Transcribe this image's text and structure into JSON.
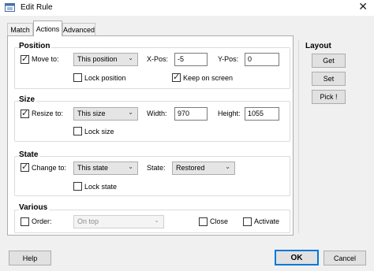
{
  "window": {
    "title": "Edit Rule",
    "close_glyph": "✕",
    "app_icon": "window-rule-icon"
  },
  "tabs": [
    {
      "label": "Match",
      "active": false
    },
    {
      "label": "Actions",
      "active": true
    },
    {
      "label": "Advanced",
      "active": false
    }
  ],
  "position": {
    "title": "Position",
    "move_to": {
      "label": "Move to:",
      "checked": true
    },
    "mode_select": "This position",
    "xpos_label": "X-Pos:",
    "xpos_value": "-5",
    "ypos_label": "Y-Pos:",
    "ypos_value": "0",
    "lock_position": {
      "label": "Lock position",
      "checked": false
    },
    "keep_on_screen": {
      "label": "Keep on screen",
      "checked": true
    }
  },
  "size": {
    "title": "Size",
    "resize_to": {
      "label": "Resize to:",
      "checked": true
    },
    "mode_select": "This size",
    "width_label": "Width:",
    "width_value": "970",
    "height_label": "Height:",
    "height_value": "1055",
    "lock_size": {
      "label": "Lock size",
      "checked": false
    }
  },
  "state": {
    "title": "State",
    "change_to": {
      "label": "Change to:",
      "checked": true
    },
    "mode_select": "This state",
    "state_label": "State:",
    "state_value": "Restored",
    "lock_state": {
      "label": "Lock state",
      "checked": false
    }
  },
  "various": {
    "title": "Various",
    "order": {
      "label": "Order:",
      "checked": false
    },
    "order_select": "On top",
    "close": {
      "label": "Close",
      "checked": false
    },
    "activate": {
      "label": "Activate",
      "checked": false
    }
  },
  "layout": {
    "title": "Layout",
    "get": "Get",
    "set": "Set",
    "pick": "Pick !"
  },
  "footer": {
    "help": "Help",
    "ok": "OK",
    "cancel": "Cancel"
  },
  "colors": {
    "accent": "#0078d7",
    "panel": "#ffffff",
    "background": "#f0f0f0"
  }
}
